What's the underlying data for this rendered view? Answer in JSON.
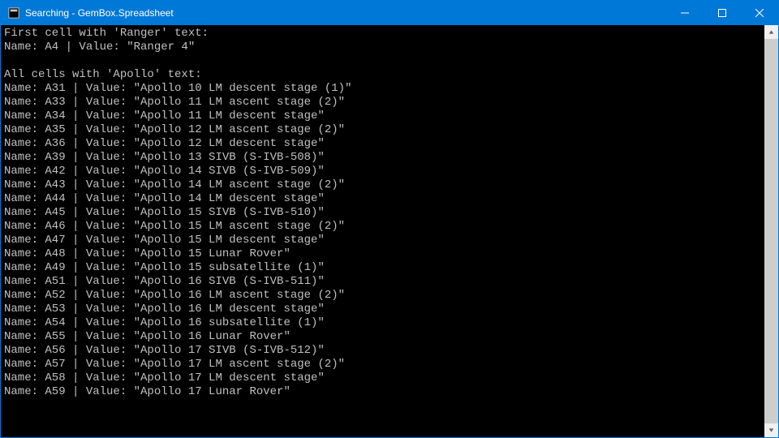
{
  "window": {
    "title": "Searching - GemBox.Spreadsheet"
  },
  "console": {
    "section1_header": "First cell with 'Ranger' text:",
    "section1_line": "Name: A4 | Value: \"Ranger 4\"",
    "section2_header": "All cells with 'Apollo' text:",
    "rows": [
      {
        "name": "A31",
        "value": "Apollo 10 LM descent stage (1)"
      },
      {
        "name": "A33",
        "value": "Apollo 11 LM ascent stage (2)"
      },
      {
        "name": "A34",
        "value": "Apollo 11 LM descent stage"
      },
      {
        "name": "A35",
        "value": "Apollo 12 LM ascent stage (2)"
      },
      {
        "name": "A36",
        "value": "Apollo 12 LM descent stage"
      },
      {
        "name": "A39",
        "value": "Apollo 13 SIVB (S-IVB-508)"
      },
      {
        "name": "A42",
        "value": "Apollo 14 SIVB (S-IVB-509)"
      },
      {
        "name": "A43",
        "value": "Apollo 14 LM ascent stage (2)"
      },
      {
        "name": "A44",
        "value": "Apollo 14 LM descent stage"
      },
      {
        "name": "A45",
        "value": "Apollo 15 SIVB (S-IVB-510)"
      },
      {
        "name": "A46",
        "value": "Apollo 15 LM ascent stage (2)"
      },
      {
        "name": "A47",
        "value": "Apollo 15 LM descent stage"
      },
      {
        "name": "A48",
        "value": "Apollo 15 Lunar Rover"
      },
      {
        "name": "A49",
        "value": "Apollo 15 subsatellite (1)"
      },
      {
        "name": "A51",
        "value": "Apollo 16 SIVB (S-IVB-511)"
      },
      {
        "name": "A52",
        "value": "Apollo 16 LM ascent stage (2)"
      },
      {
        "name": "A53",
        "value": "Apollo 16 LM descent stage"
      },
      {
        "name": "A54",
        "value": "Apollo 16 subsatellite (1)"
      },
      {
        "name": "A55",
        "value": "Apollo 16 Lunar Rover"
      },
      {
        "name": "A56",
        "value": "Apollo 17 SIVB (S-IVB-512)"
      },
      {
        "name": "A57",
        "value": "Apollo 17 LM ascent stage (2)"
      },
      {
        "name": "A58",
        "value": "Apollo 17 LM descent stage"
      },
      {
        "name": "A59",
        "value": "Apollo 17 Lunar Rover"
      }
    ]
  }
}
